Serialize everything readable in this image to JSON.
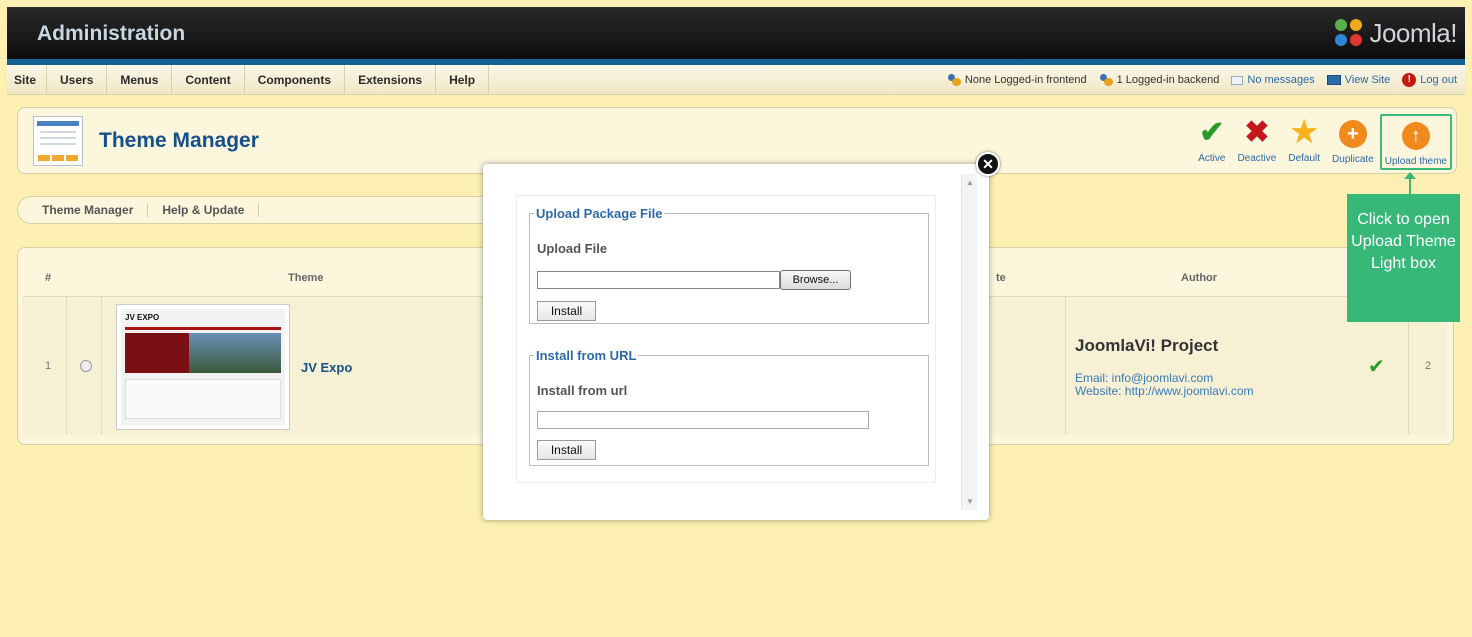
{
  "header": {
    "title": "Administration",
    "logo_text": "Joomla!"
  },
  "menu": {
    "items": [
      "Site",
      "Users",
      "Menus",
      "Content",
      "Components",
      "Extensions",
      "Help"
    ]
  },
  "status": {
    "frontend": "None Logged-in frontend",
    "backend": "1 Logged-in backend",
    "messages": "No messages",
    "view_site": "View Site",
    "logout": "Log out"
  },
  "toolbar": {
    "page_title": "Theme Manager",
    "buttons": [
      {
        "label": "Active",
        "icon": "check-icon",
        "color": "#2a9a2a"
      },
      {
        "label": "Deactive",
        "icon": "x-icon",
        "color": "#c4161c"
      },
      {
        "label": "Default",
        "icon": "star-icon",
        "color": "#f4b41a"
      },
      {
        "label": "Duplicate",
        "icon": "plus-circle-icon",
        "color": "#f08a1d"
      },
      {
        "label": "Upload theme",
        "icon": "upload-circle-icon",
        "color": "#f08a1d"
      }
    ]
  },
  "submenu": {
    "items": [
      "Theme Manager",
      "Help & Update"
    ]
  },
  "table": {
    "headers": {
      "num": "#",
      "theme": "Theme",
      "partial_col": "te",
      "author": "Author"
    },
    "rows": [
      {
        "num": "1",
        "theme_name": "JV Expo",
        "thumb_logo": "JV EXPO",
        "author_name": "JoomlaVi! Project",
        "email": "Email: info@joomlavi.com",
        "website": "Website: http://www.joomlavi.com",
        "extra": "2"
      }
    ]
  },
  "callout": {
    "text": "Click to open Upload Theme Light box"
  },
  "modal": {
    "upload_section": {
      "legend": "Upload Package File",
      "label": "Upload File",
      "browse_label": "Browse...",
      "install_label": "Install"
    },
    "url_section": {
      "legend": "Install from URL",
      "label": "Install from url",
      "install_label": "Install"
    },
    "close_glyph": "✕"
  },
  "colors": {
    "background": "#fdf0b2",
    "brand_blue": "#16508a",
    "callout_green": "#38b878"
  }
}
